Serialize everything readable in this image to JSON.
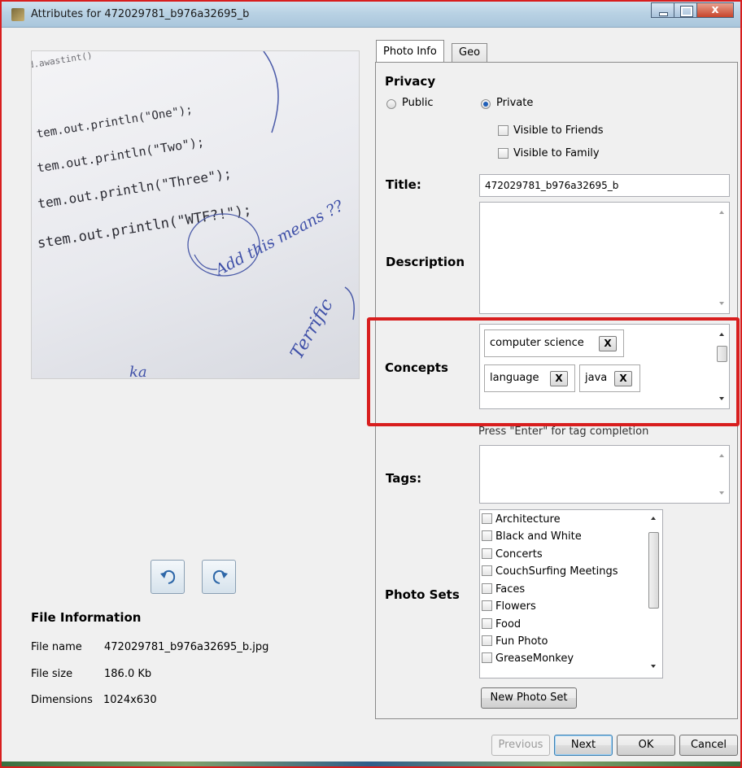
{
  "window": {
    "title": "Attributes for 472029781_b976a32695_b"
  },
  "photo": {
    "code_lines": [
      "tem.out.println(\"One\");",
      "tem.out.println(\"Two\");",
      "tem.out.println(\"Three\");",
      "stem.out.println(\"WTF?!\");"
    ]
  },
  "file_info": {
    "title": "File Information",
    "rows": [
      {
        "label": "File name",
        "value": "472029781_b976a32695_b.jpg"
      },
      {
        "label": "File size",
        "value": "186.0 Kb"
      },
      {
        "label": "Dimensions",
        "value": "1024x630"
      }
    ]
  },
  "tabs": [
    {
      "label": "Photo Info"
    },
    {
      "label": "Geo"
    }
  ],
  "privacy": {
    "label": "Privacy",
    "public": "Public",
    "private": "Private",
    "selected": "Private",
    "friends": "Visible to Friends",
    "family": "Visible to Family"
  },
  "title_field": {
    "label": "Title:",
    "value": "472029781_b976a32695_b"
  },
  "description": {
    "label": "Description",
    "value": ""
  },
  "concepts": {
    "label": "Concepts",
    "chips": [
      "computer science",
      "language",
      "java"
    ],
    "remove_label": "X"
  },
  "tags": {
    "hint": "Press \"Enter\" for tag completion",
    "label": "Tags:",
    "value": ""
  },
  "photo_sets": {
    "label": "Photo Sets",
    "items": [
      "Architecture",
      "Black and White",
      "Concerts",
      "CouchSurfing Meetings",
      "Faces",
      "Flowers",
      "Food",
      "Fun Photo",
      "GreaseMonkey"
    ],
    "new_button": "New Photo Set"
  },
  "buttons": {
    "previous": "Previous",
    "next": "Next",
    "ok": "OK",
    "cancel": "Cancel"
  },
  "colors": {
    "highlight": "#d81e1e",
    "accent": "#1f5fb8"
  }
}
